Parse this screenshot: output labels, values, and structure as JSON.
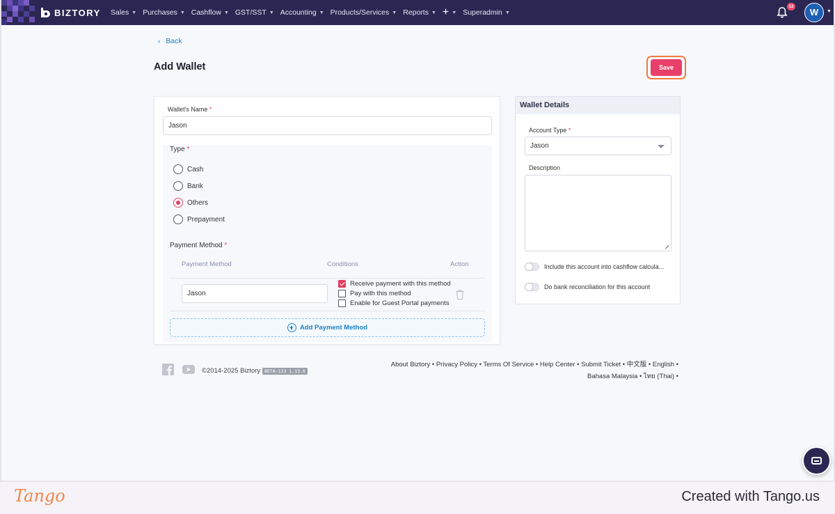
{
  "app": {
    "brand": "BIZTORY",
    "nav": [
      {
        "label": "Sales"
      },
      {
        "label": "Purchases"
      },
      {
        "label": "Cashflow"
      },
      {
        "label": "GST/SST"
      },
      {
        "label": "Accounting"
      },
      {
        "label": "Products/Services"
      },
      {
        "label": "Reports"
      }
    ],
    "nav_plus": "+",
    "nav_superadmin": "Superadmin",
    "notification_count": "12",
    "avatar_initial": "W"
  },
  "page": {
    "back_label": "Back",
    "title": "Add Wallet",
    "save_label": "Save"
  },
  "form": {
    "wallet_name_label": "Wallet's Name",
    "wallet_name_value": "Jason",
    "type_label": "Type",
    "type_options": [
      {
        "label": "Cash",
        "selected": false
      },
      {
        "label": "Bank",
        "selected": false
      },
      {
        "label": "Others",
        "selected": true
      },
      {
        "label": "Prepayment",
        "selected": false
      }
    ],
    "payment_method_label": "Payment Method",
    "table_headers": {
      "method": "Payment Method",
      "conditions": "Conditions",
      "action": "Action"
    },
    "payment_row": {
      "method_value": "Jason",
      "conditions": [
        {
          "label": "Receive payment with this method",
          "checked": true
        },
        {
          "label": "Pay with this method",
          "checked": false
        },
        {
          "label": "Enable for Guest Portal payments",
          "checked": false
        }
      ]
    },
    "add_method_label": "Add Payment Method",
    "required_mark": "*"
  },
  "details": {
    "title": "Wallet Details",
    "account_type_label": "Account Type",
    "account_type_value": "Jason",
    "description_label": "Description",
    "toggles": [
      {
        "label": "Include this account into cashflow calcula...",
        "on": false
      },
      {
        "label": "Do bank reconciliation for this account",
        "on": false
      }
    ]
  },
  "footer": {
    "copyright": "©2014-2025 Biztory",
    "version": "BETA-123 1.13.0",
    "links_line1": "About Biztory • Privacy Policy • Terms Of Service • Help Center • Submit Ticket • 中文版 • English •",
    "links_line2": "Bahasa Malaysia • ไทย (Thai) •"
  },
  "watermark": {
    "logo": "Tango",
    "text": "Created with Tango.us"
  },
  "colors": {
    "topbar": "#2c2752",
    "accent": "#e8406b",
    "link": "#1d7fc2",
    "highlight": "#f07b3d"
  }
}
